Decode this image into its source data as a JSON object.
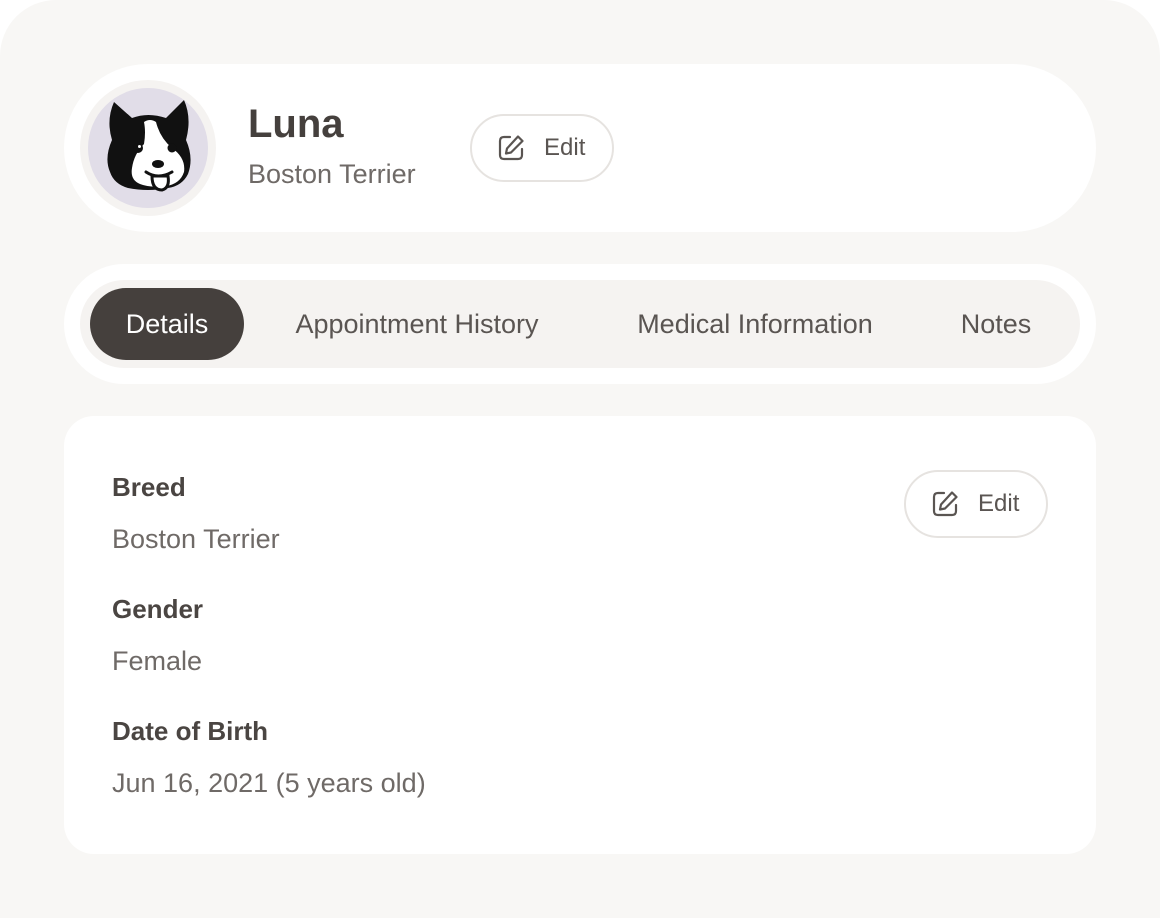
{
  "pet": {
    "name": "Luna",
    "breed": "Boston Terrier",
    "avatar_icon": "dog-face-icon",
    "edit_label": "Edit"
  },
  "tabs": [
    {
      "label": "Details",
      "active": true
    },
    {
      "label": "Appointment History",
      "active": false
    },
    {
      "label": "Medical Information",
      "active": false
    },
    {
      "label": "Notes",
      "active": false
    }
  ],
  "details": {
    "edit_label": "Edit",
    "fields": [
      {
        "label": "Breed",
        "value": "Boston Terrier"
      },
      {
        "label": "Gender",
        "value": "Female"
      },
      {
        "label": "Date of Birth",
        "value": "Jun 16, 2021 (5 years old)"
      }
    ]
  },
  "colors": {
    "background": "#f8f7f5",
    "card": "#ffffff",
    "active_tab": "#45403d",
    "avatar_bg": "#e1dde8",
    "text_primary": "#45403d",
    "text_secondary": "#6f6a67"
  }
}
